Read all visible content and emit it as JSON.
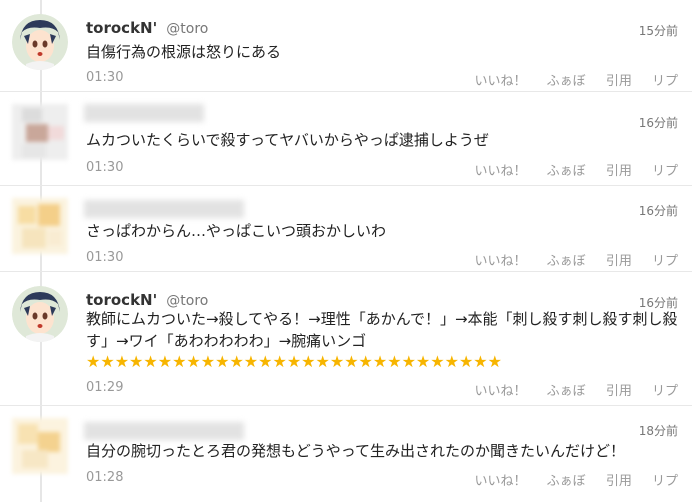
{
  "tweets": [
    {
      "name": "torockN'",
      "handle": "@toro",
      "time_rel": "15分前",
      "text": "自傷行為の根源は怒りにある",
      "time": "01:30",
      "avatar": "anime-character-avatar"
    },
    {
      "name": "",
      "handle": "",
      "time_rel": "16分前",
      "text": "ムカついたくらいで殺すってヤバいからやっぱ逮捕しようぜ",
      "time": "01:30",
      "avatar": "blurred-avatar"
    },
    {
      "name": "",
      "handle": "",
      "time_rel": "16分前",
      "text": "さっぱわからん…やっぱこいつ頭おかしいわ",
      "time": "01:30",
      "avatar": "blurred-avatar"
    },
    {
      "name": "torockN'",
      "handle": "@toro",
      "time_rel": "16分前",
      "text": "教師にムカついた→殺してやる！→理性「あかんで！」→本能「刺し殺す刺し殺す刺し殺す」→ワイ「あわわわわわ」→腕痛いンゴ",
      "stars": "★★★★★★★★★★★★★★★★★★★★★★★★★★★★★",
      "time": "01:29",
      "avatar": "anime-character-avatar"
    },
    {
      "name": "",
      "handle": "",
      "time_rel": "18分前",
      "text": "自分の腕切ったとろ君の発想もどうやって生み出されたのか聞きたいんだけど！",
      "time": "01:28",
      "avatar": "blurred-avatar"
    }
  ],
  "actions": {
    "like": "いいね！",
    "fav": "ふぁぼ",
    "quote": "引用",
    "reply": "リプ"
  },
  "colors": {
    "star": "#f7b500",
    "meta": "#999999",
    "border": "#e8e8e8"
  }
}
